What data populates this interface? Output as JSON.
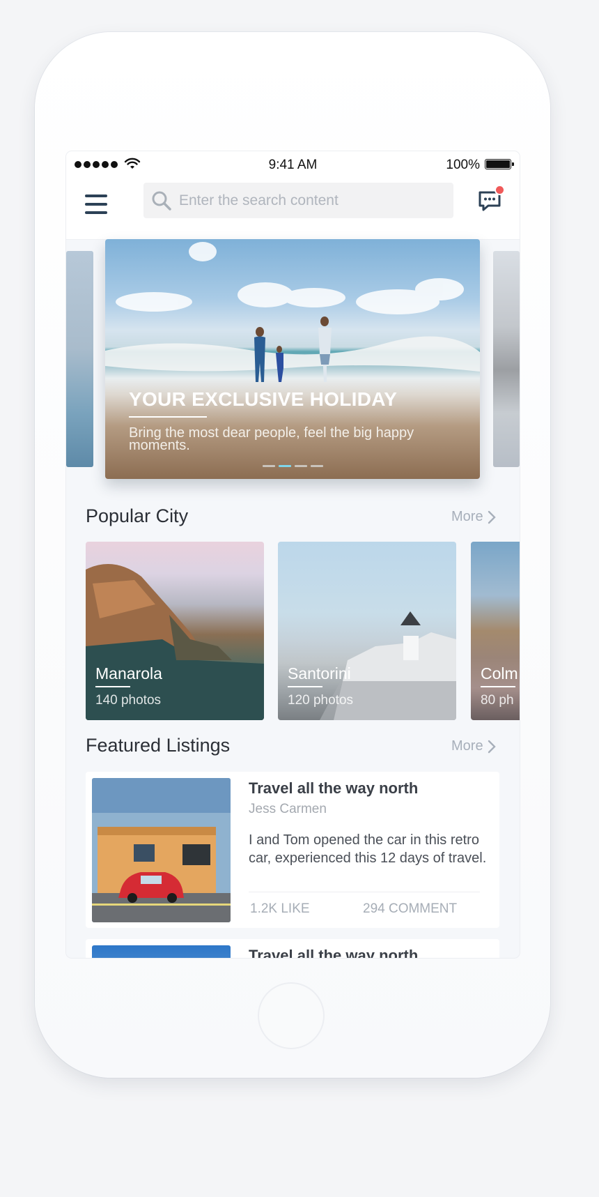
{
  "status_bar": {
    "time": "9:41 AM",
    "battery": "100%"
  },
  "search": {
    "placeholder": "Enter the search content"
  },
  "icons": {
    "menu": "hamburger-icon",
    "search": "magnifier-icon",
    "chat": "chat-bubble-icon",
    "chevron": "chevron-right-icon"
  },
  "banner": {
    "title": "YOUR EXCLUSIVE HOLIDAY",
    "subtitle": "Bring the most dear people, feel the big happy moments.",
    "slide_count": 4,
    "active_slide": 2
  },
  "popular": {
    "title": "Popular City",
    "more": "More",
    "cities": [
      {
        "name": "Manarola",
        "photos": "140 photos"
      },
      {
        "name": "Santorini",
        "photos": "120 photos"
      },
      {
        "name": "Colm",
        "photos": "80 ph"
      }
    ]
  },
  "featured": {
    "title": "Featured Listings",
    "more": "More",
    "listings": [
      {
        "title": "Travel all the way north",
        "author": "Jess Carmen",
        "description": "I and Tom opened the car in this retro car, experienced this 12 days of travel.",
        "likes": "1.2K LIKE",
        "comments": "294 COMMENT"
      },
      {
        "title": "Travel all the way north"
      }
    ]
  },
  "colors": {
    "accent_dot": "#7fd6ea",
    "notification": "#f05a5a",
    "icon_dark": "#2c4156"
  }
}
